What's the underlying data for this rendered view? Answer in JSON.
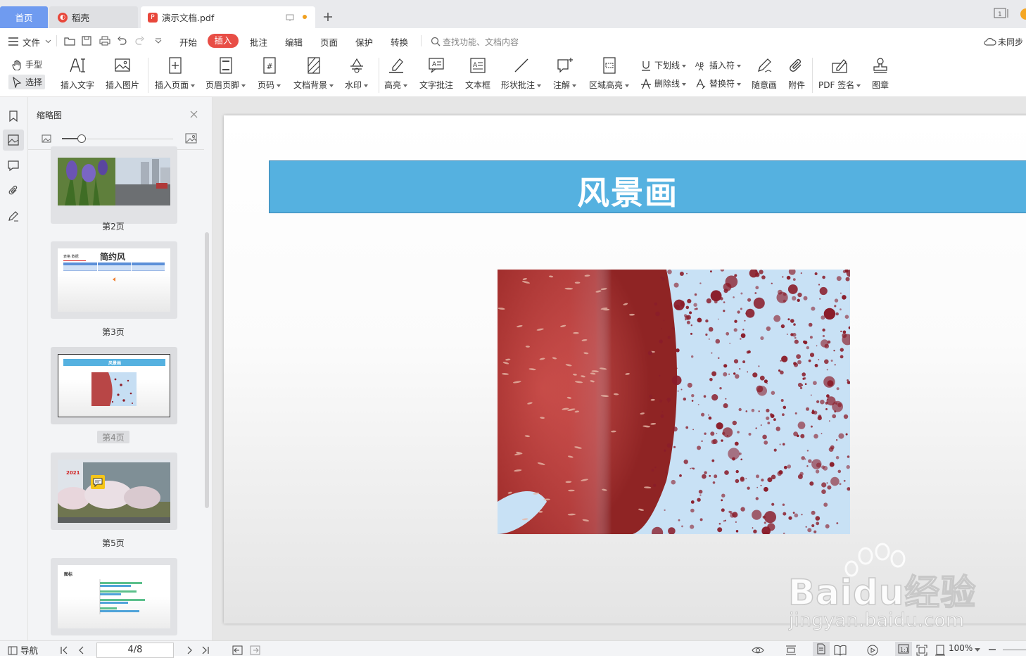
{
  "tabs": {
    "home": "首页",
    "daoke": "稻壳",
    "doc": "演示文档.pdf"
  },
  "menu": {
    "file": "文件",
    "items": [
      "开始",
      "插入",
      "批注",
      "编辑",
      "页面",
      "保护",
      "转换"
    ],
    "search_placeholder": "查找功能、文档内容",
    "sync": "未同步"
  },
  "ribbon": {
    "hand": "手型",
    "select": "选择",
    "insert_text": "插入文字",
    "insert_image": "插入图片",
    "insert_page": "插入页面",
    "header_footer": "页眉页脚",
    "page_number": "页码",
    "doc_background": "文档背景",
    "watermark": "水印",
    "highlight": "高亮",
    "text_comment": "文字批注",
    "text_box": "文本框",
    "shape_comment": "形状批注",
    "annotation": "注解",
    "area_highlight": "区域高亮",
    "underline": "下划线",
    "strikethrough": "删除线",
    "insert_mark": "插入符",
    "replace_mark": "替换符",
    "freehand": "随意画",
    "attachment": "附件",
    "pdf_sign": "PDF 签名",
    "stamp": "图章"
  },
  "thumbpanel": {
    "title": "缩略图",
    "pages": [
      {
        "label": "第2页"
      },
      {
        "label": "第3页",
        "mini_title": "简约风",
        "mini_caption": "表格 数据"
      },
      {
        "label": "第4页",
        "mini_title": "风景画"
      },
      {
        "label": "第5页",
        "mini_year": "2021"
      },
      {
        "label": "",
        "mini_title": "图标"
      }
    ]
  },
  "slide": {
    "title": "风景画"
  },
  "status": {
    "nav": "导航",
    "page_indicator": "4/8",
    "zoom": "100%"
  },
  "watermark": {
    "brand": "Baidu经验",
    "url": "jingyan.baidu.com"
  },
  "colors": {
    "accent_red": "#e84e46",
    "home_tab": "#6f9bf0",
    "title_band": "#55b1e0"
  }
}
